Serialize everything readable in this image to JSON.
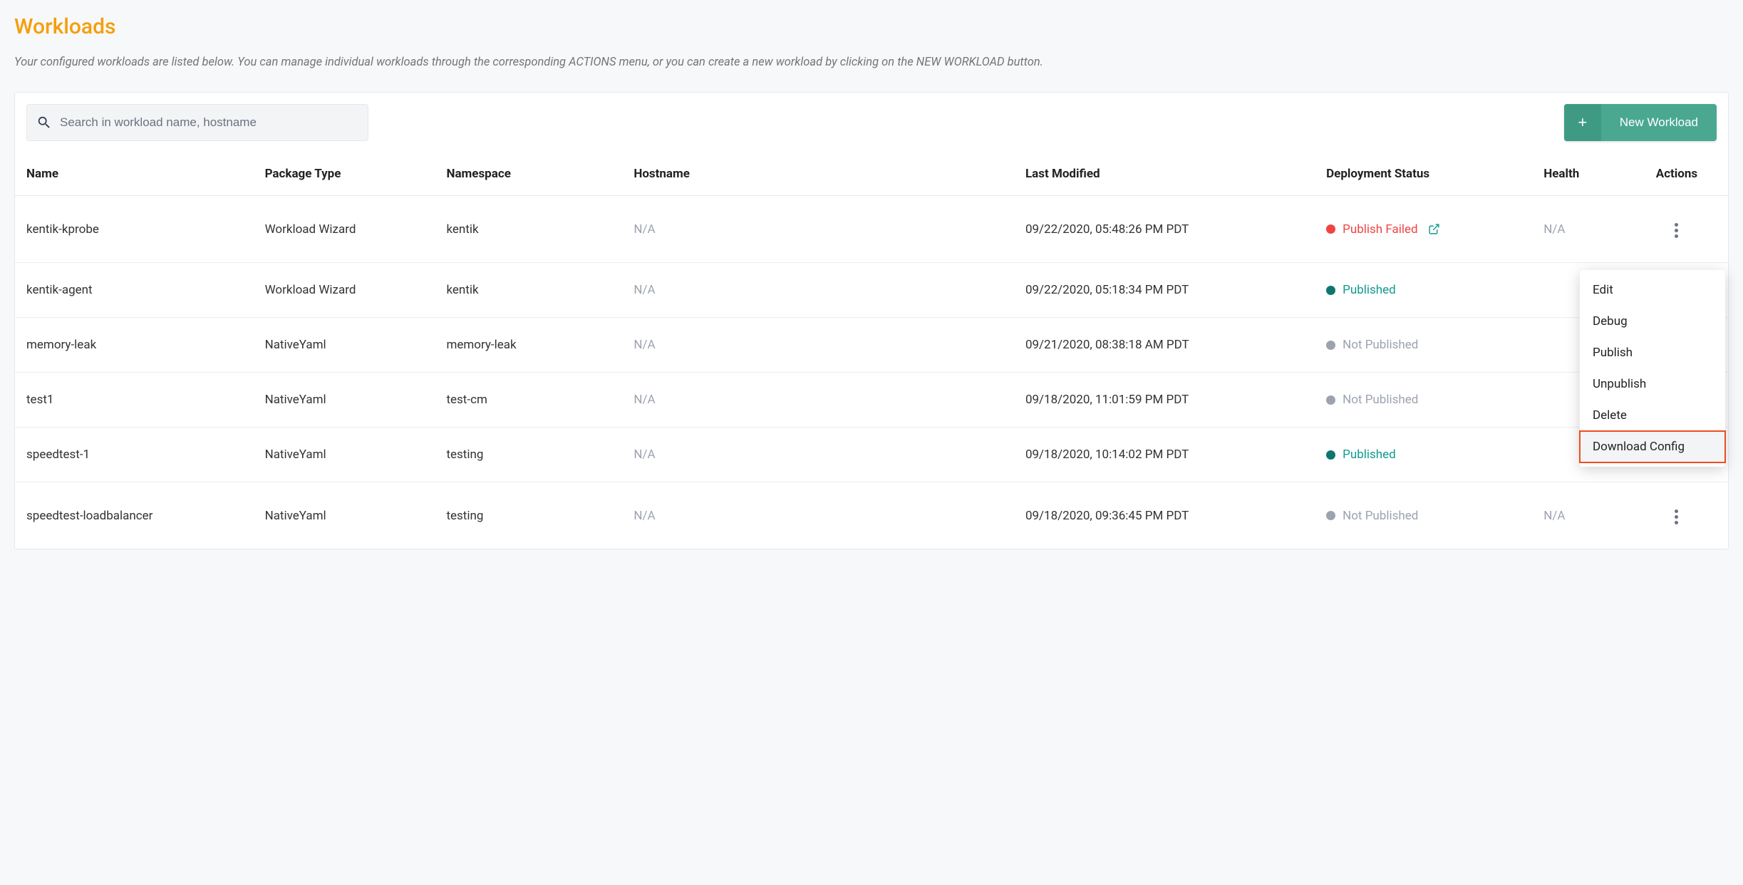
{
  "page": {
    "title": "Workloads",
    "subtitle": "Your configured workloads are listed below. You can manage individual workloads through the corresponding ACTIONS menu, or you can create a new workload by clicking on the NEW WORKLOAD button."
  },
  "search": {
    "placeholder": "Search in workload name, hostname"
  },
  "buttons": {
    "new_workload": "New Workload"
  },
  "columns": {
    "name": "Name",
    "package_type": "Package Type",
    "namespace": "Namespace",
    "hostname": "Hostname",
    "last_modified": "Last Modified",
    "deployment_status": "Deployment Status",
    "health": "Health",
    "actions": "Actions"
  },
  "status_labels": {
    "publish_failed": "Publish Failed",
    "published": "Published",
    "not_published": "Not Published"
  },
  "na": "N/A",
  "rows": [
    {
      "name": "kentik-kprobe",
      "package_type": "Workload Wizard",
      "namespace": "kentik",
      "hostname": "N/A",
      "last_modified": "09/22/2020, 05:48:26 PM PDT",
      "status": "publish_failed",
      "health": "N/A",
      "has_external_link": true,
      "show_kebab": true
    },
    {
      "name": "kentik-agent",
      "package_type": "Workload Wizard",
      "namespace": "kentik",
      "hostname": "N/A",
      "last_modified": "09/22/2020, 05:18:34 PM PDT",
      "status": "published",
      "health": "",
      "has_external_link": false,
      "show_kebab": false
    },
    {
      "name": "memory-leak",
      "package_type": "NativeYaml",
      "namespace": "memory-leak",
      "hostname": "N/A",
      "last_modified": "09/21/2020, 08:38:18 AM PDT",
      "status": "not_published",
      "health": "",
      "has_external_link": false,
      "show_kebab": false
    },
    {
      "name": "test1",
      "package_type": "NativeYaml",
      "namespace": "test-cm",
      "hostname": "N/A",
      "last_modified": "09/18/2020, 11:01:59 PM PDT",
      "status": "not_published",
      "health": "",
      "has_external_link": false,
      "show_kebab": false
    },
    {
      "name": "speedtest-1",
      "package_type": "NativeYaml",
      "namespace": "testing",
      "hostname": "N/A",
      "last_modified": "09/18/2020, 10:14:02 PM PDT",
      "status": "published",
      "health": "",
      "has_external_link": false,
      "show_kebab": false
    },
    {
      "name": "speedtest-loadbalancer",
      "package_type": "NativeYaml",
      "namespace": "testing",
      "hostname": "N/A",
      "last_modified": "09/18/2020, 09:36:45 PM PDT",
      "status": "not_published",
      "health": "N/A",
      "has_external_link": false,
      "show_kebab": true
    }
  ],
  "menu": {
    "items": [
      "Edit",
      "Debug",
      "Publish",
      "Unpublish",
      "Delete",
      "Download Config"
    ],
    "highlight_index": 5
  },
  "colors": {
    "accent_orange": "#f59e0b",
    "teal": "#0f9b8e",
    "red": "#ef4444",
    "gray": "#9ca3af"
  }
}
